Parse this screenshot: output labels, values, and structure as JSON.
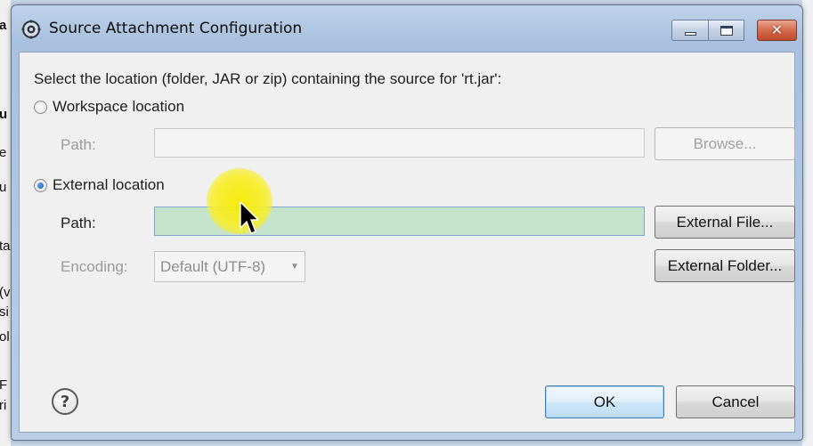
{
  "window": {
    "title": "Source Attachment Configuration",
    "controls": {
      "minimize": "minimize",
      "maximize": "maximize",
      "close": "close"
    }
  },
  "dialog": {
    "prompt": "Select the location (folder, JAR or zip) containing the source for 'rt.jar':",
    "workspace": {
      "label": "Workspace location",
      "selected": false,
      "path_label": "Path:",
      "path_value": "",
      "browse_label": "Browse..."
    },
    "external": {
      "label": "External location",
      "selected": true,
      "path_label": "Path:",
      "path_value": "",
      "external_file_label": "External File...",
      "encoding_label": "Encoding:",
      "encoding_value": "Default (UTF-8)",
      "external_folder_label": "External Folder..."
    },
    "help_glyph": "?",
    "ok_label": "OK",
    "cancel_label": "Cancel"
  },
  "background_window": {
    "fragments": [
      "a",
      "u",
      "e",
      "u",
      "ta",
      "(v",
      "si",
      "ol",
      "F",
      "ri"
    ]
  },
  "colors": {
    "active_path_fill": "#c5e3cb",
    "titlebar": "#b3c9e3",
    "close_button": "#c94f30",
    "cursor_highlight": "#f5ea00"
  },
  "icons": {
    "app": "gear-icon",
    "help": "help-icon",
    "combo_arrow": "chevron-down-icon",
    "pointer": "mouse-pointer-icon"
  }
}
